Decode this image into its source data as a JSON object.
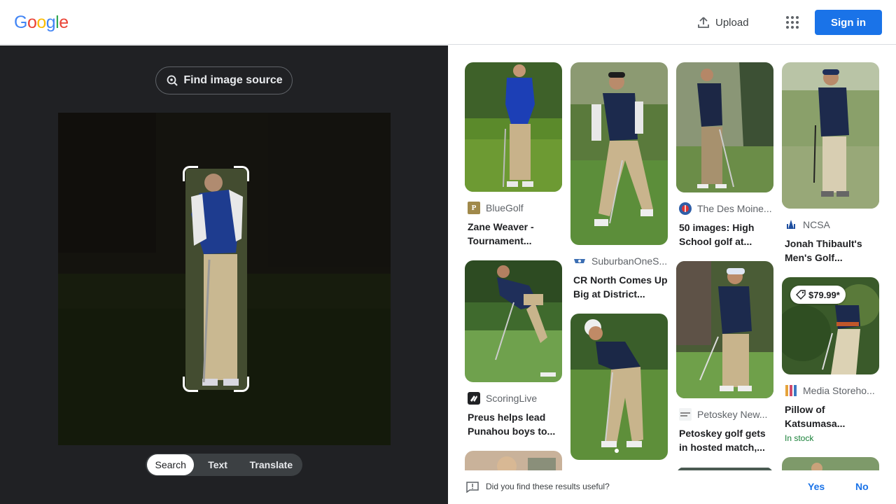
{
  "header": {
    "logo_letters": [
      "G",
      "o",
      "o",
      "g",
      "l",
      "e"
    ],
    "logo_colors": [
      "#4285f4",
      "#ea4335",
      "#fbbc05",
      "#4285f4",
      "#34a853",
      "#ea4335"
    ],
    "upload_label": "Upload",
    "apps_icon": "apps-grid-icon",
    "signin_label": "Sign in"
  },
  "left": {
    "find_source_label": "Find image source",
    "modes": [
      "Search",
      "Text",
      "Translate"
    ],
    "active_mode": "Search"
  },
  "results": [
    {
      "source": "BlueGolf",
      "title": "Zane Weaver - Tournament...",
      "favicon_color": "#a0894a",
      "favicon_text": "P"
    },
    {
      "source": "SuburbanOneS...",
      "title": "CR North Comes Up Big at District...",
      "favicon_color": "#3b6eb3",
      "favicon_text": ""
    },
    {
      "source": "The Des Moine...",
      "title": "50 images: High School golf at...",
      "favicon_color": "#2e5ea8",
      "favicon_text": ""
    },
    {
      "source": "NCSA",
      "title": "Jonah Thibault's Men's Golf...",
      "favicon_color": "#1f4fa0",
      "favicon_text": ""
    },
    {
      "source": "ScoringLive",
      "title": "Preus helps lead Punahou boys to...",
      "favicon_color": "#202124",
      "favicon_text": ""
    },
    {
      "source": "",
      "title": "",
      "favicon_color": "",
      "favicon_text": ""
    },
    {
      "source": "Petoskey New...",
      "title": "Petoskey golf gets in hosted match,...",
      "favicon_color": "#888888",
      "favicon_text": ""
    },
    {
      "source": "Media Storeho...",
      "title": "Pillow of Katsumasa...",
      "favicon_color": "#e5a33b",
      "favicon_text": "",
      "price": "$79.99*",
      "stock": "In stock"
    }
  ],
  "feedback": {
    "question": "Did you find these results useful?",
    "yes": "Yes",
    "no": "No"
  }
}
